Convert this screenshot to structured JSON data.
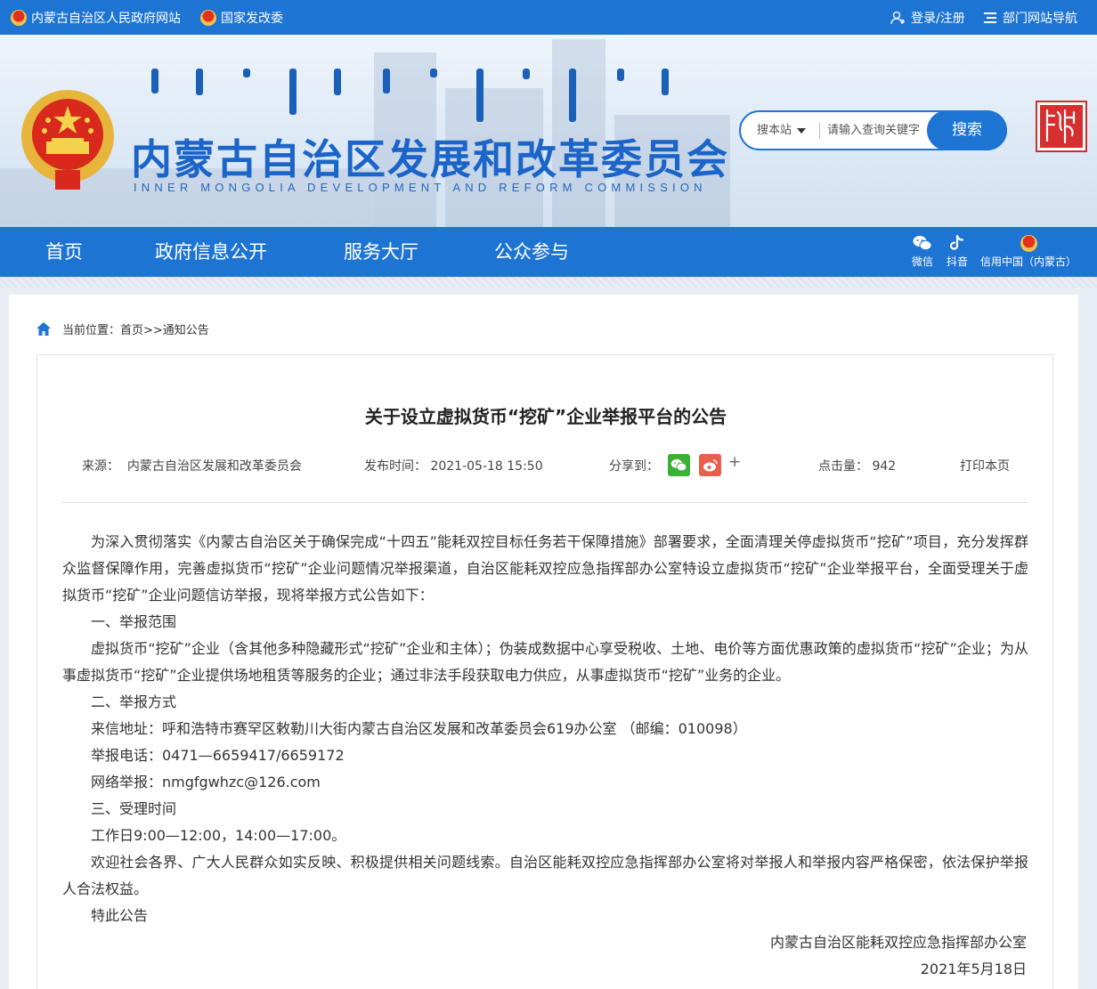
{
  "topbar": {
    "link1": "内蒙古自治区人民政府网站",
    "link2": "国家发改委",
    "login": "登录/注册",
    "dept_nav": "部门网站导航"
  },
  "header": {
    "title": "内蒙古自治区发展和改革委员会",
    "subtitle": "INNER MONGOLIA DEVELOPMENT AND REFORM COMMISSION",
    "search_scope": "搜本站",
    "search_placeholder": "请输入查询关键字",
    "search_button": "搜索",
    "seal_text": "内蒙古"
  },
  "nav": {
    "items": [
      "首页",
      "政府信息公开",
      "服务大厅",
      "公众参与"
    ],
    "social": [
      "微信",
      "抖音",
      "信用中国（内蒙古）"
    ]
  },
  "breadcrumb": {
    "label": "当前位置：",
    "path": "首页>>通知公告"
  },
  "article": {
    "title": "关于设立虚拟货币“挖矿”企业举报平台的公告",
    "source_label": "来源：",
    "source": "内蒙古自治区发展和改革委员会",
    "date_label": "发布时间：",
    "date": "2021-05-18 15:50",
    "share_label": "分享到：",
    "share_more": "+",
    "hits_label": "点击量：",
    "hits": "942",
    "print": "打印本页",
    "paragraphs": [
      "为深入贯彻落实《内蒙古自治区关于确保完成“十四五”能耗双控目标任务若干保障措施》部署要求，全面清理关停虚拟货币“挖矿”项目，充分发挥群众监督保障作用，完善虚拟货币“挖矿”企业问题情况举报渠道，自治区能耗双控应急指挥部办公室特设立虚拟货币“挖矿”企业举报平台，全面受理关于虚拟货币“挖矿”企业问题信访举报，现将举报方式公告如下：",
      "一、举报范围",
      "虚拟货币“挖矿”企业（含其他多种隐藏形式“挖矿”企业和主体）；伪装成数据中心享受税收、土地、电价等方面优惠政策的虚拟货币“挖矿”企业；为从事虚拟货币“挖矿”企业提供场地租赁等服务的企业；通过非法手段获取电力供应，从事虚拟货币“挖矿”业务的企业。",
      "二、举报方式",
      "来信地址：呼和浩特市赛罕区敕勒川大街内蒙古自治区发展和改革委员会619办公室 （邮编：010098）",
      "举报电话：0471—6659417/6659172",
      "网络举报：nmgfgwhzc@126.com",
      "三、受理时间",
      "工作日9:00—12:00，14:00—17:00。",
      "欢迎社会各界、广大人民群众如实反映、积极提供相关问题线索。自治区能耗双控应急指挥部办公室将对举报人和举报内容严格保密，依法保护举报人合法权益。",
      "特此公告"
    ],
    "signature": "内蒙古自治区能耗双控应急指挥部办公室",
    "sign_date": "2021年5月18日"
  },
  "colors": {
    "primary": "#1e74d3",
    "wechat": "#3cb034",
    "weibo": "#e8604c"
  }
}
